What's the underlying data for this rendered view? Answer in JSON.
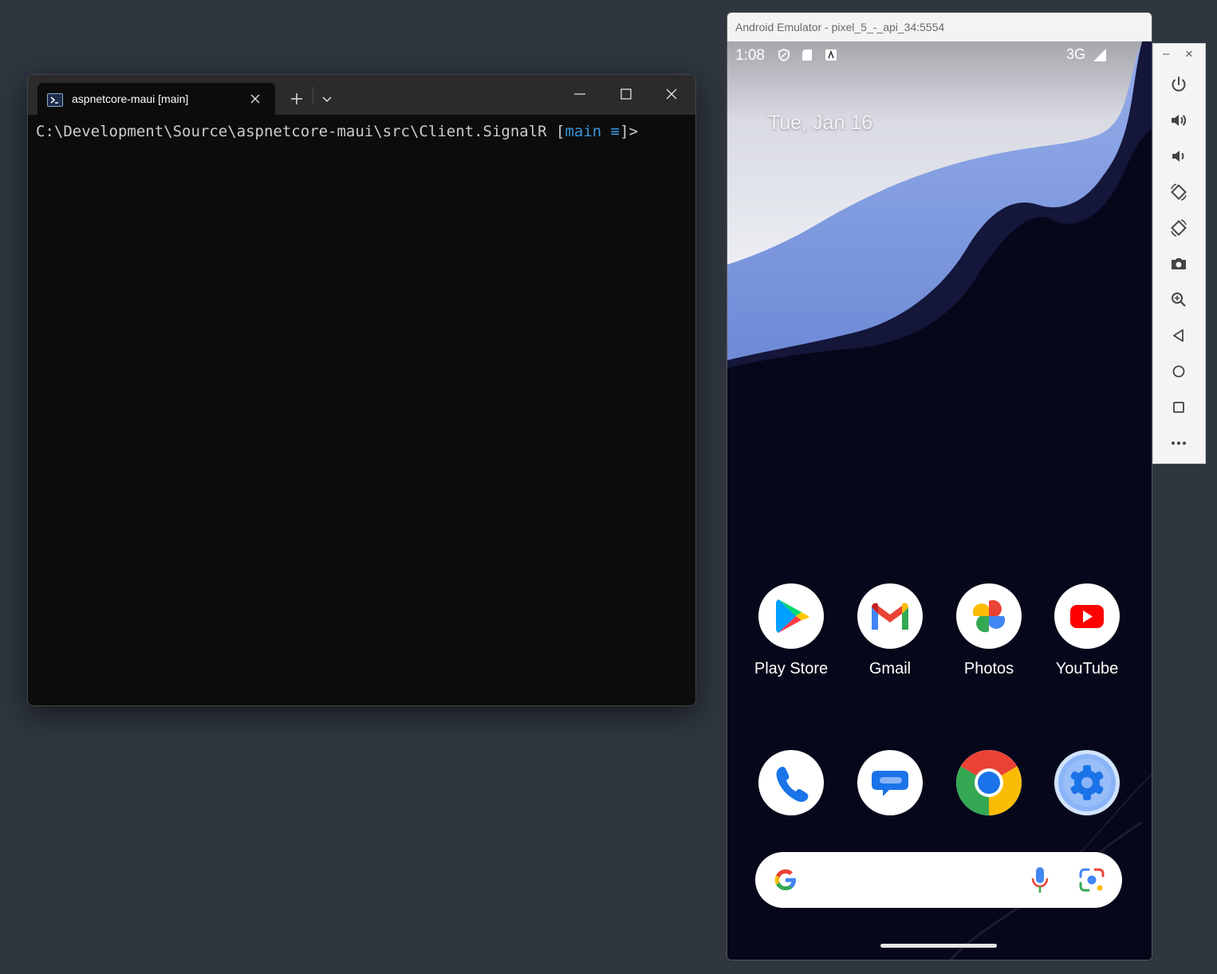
{
  "terminal": {
    "tab_title": "aspnetcore-maui [main]",
    "new_tab_label": "+",
    "prompt": {
      "path": "C:\\Development\\Source\\aspnetcore-maui\\src\\Client.SignalR",
      "open": " [",
      "branch": "main ≡",
      "close": "]>"
    }
  },
  "emulator": {
    "window_title": "Android Emulator - pixel_5_-_api_34:5554",
    "status_bar": {
      "time": "1:08",
      "network": "3G"
    },
    "date": "Tue, Jan 16",
    "apps_row1": [
      {
        "label": "Play Store",
        "icon": "play-store-icon"
      },
      {
        "label": "Gmail",
        "icon": "gmail-icon"
      },
      {
        "label": "Photos",
        "icon": "photos-icon"
      },
      {
        "label": "YouTube",
        "icon": "youtube-icon"
      }
    ],
    "apps_row2": [
      {
        "icon": "phone-icon"
      },
      {
        "icon": "messages-icon"
      },
      {
        "icon": "chrome-icon"
      },
      {
        "icon": "settings-icon"
      }
    ],
    "search_bar": {
      "icons": [
        "google-g-icon",
        "microphone-icon",
        "lens-icon"
      ]
    }
  },
  "emulator_toolbar": {
    "minimize_label": "–",
    "close_label": "×",
    "buttons": [
      "power-icon",
      "volume-up-icon",
      "volume-down-icon",
      "rotate-left-icon",
      "rotate-right-icon",
      "camera-icon",
      "zoom-icon",
      "back-icon",
      "home-icon",
      "overview-icon",
      "more-icon"
    ]
  },
  "colors": {
    "desktop": "#2f3640",
    "terminal_bg": "#0c0c0c",
    "branch": "#3a96dd"
  }
}
